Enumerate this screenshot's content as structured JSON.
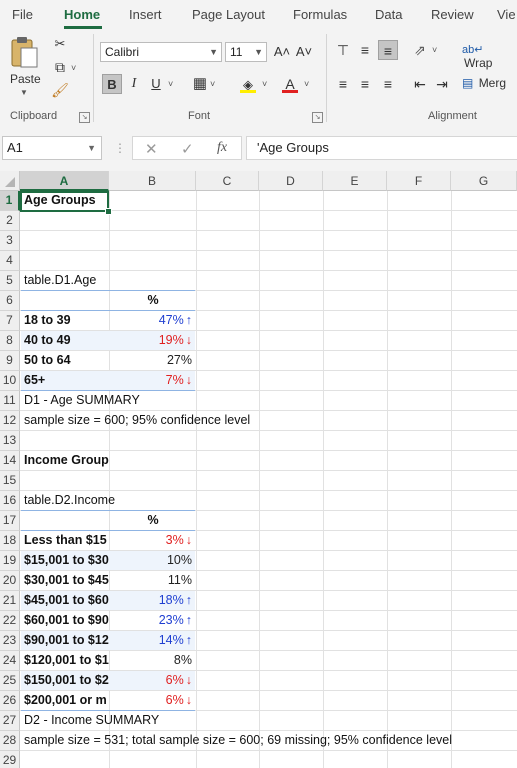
{
  "ribbon": {
    "tabs": [
      "File",
      "Home",
      "Insert",
      "Page Layout",
      "Formulas",
      "Data",
      "Review",
      "Vie"
    ],
    "active_tab": "Home",
    "clipboard": {
      "paste_label": "Paste",
      "group_label": "Clipboard"
    },
    "font": {
      "name": "Calibri",
      "size": "11",
      "bold": "B",
      "italic": "I",
      "underline": "U",
      "grow": "A˄",
      "shrink": "A˅",
      "font_color_letter": "A",
      "group_label": "Font"
    },
    "alignment": {
      "wrap_label": "Wrap",
      "merge_label": "Merg",
      "group_label": "Alignment"
    },
    "colors": {
      "accent": "#1e6c41",
      "highlight": "#ffee00",
      "font_color": "#e02020"
    }
  },
  "formula_bar": {
    "name_box": "A1",
    "formula": "'Age Groups",
    "fx_label": "fx"
  },
  "columns": [
    "A",
    "B",
    "C",
    "D",
    "E",
    "F",
    "G"
  ],
  "rows": [
    "1",
    "2",
    "3",
    "4",
    "5",
    "6",
    "7",
    "8",
    "9",
    "10",
    "11",
    "12",
    "13",
    "14",
    "15",
    "16",
    "17",
    "18",
    "19",
    "20",
    "21",
    "22",
    "23",
    "24",
    "25",
    "26",
    "27",
    "28",
    "29"
  ],
  "age": {
    "title": "Age Groups",
    "table_name": "table.D1.Age",
    "pct_header": "%",
    "rows": [
      {
        "label": "18 to 39",
        "value": "47%",
        "arrow": "↑",
        "trend": "up"
      },
      {
        "label": "40 to 49",
        "value": "19%",
        "arrow": "↓",
        "trend": "down"
      },
      {
        "label": "50 to 64",
        "value": "27%",
        "arrow": "",
        "trend": "neutral"
      },
      {
        "label": "65+",
        "value": "7%",
        "arrow": "↓",
        "trend": "down"
      }
    ],
    "summary": "D1 - Age SUMMARY",
    "sample": "sample size = 600; 95% confidence level"
  },
  "income": {
    "title": "Income Groups",
    "table_name": "table.D2.Income",
    "pct_header": "%",
    "rows": [
      {
        "label": "Less than $15",
        "value": "3%",
        "arrow": "↓",
        "trend": "down"
      },
      {
        "label": "$15,001 to $30",
        "value": "10%",
        "arrow": "",
        "trend": "neutral"
      },
      {
        "label": "$30,001 to $45",
        "value": "11%",
        "arrow": "",
        "trend": "neutral"
      },
      {
        "label": "$45,001 to $60",
        "value": "18%",
        "arrow": "↑",
        "trend": "up"
      },
      {
        "label": "$60,001 to $90",
        "value": "23%",
        "arrow": "↑",
        "trend": "up"
      },
      {
        "label": "$90,001 to $12",
        "value": "14%",
        "arrow": "↑",
        "trend": "up"
      },
      {
        "label": "$120,001 to $1",
        "value": "8%",
        "arrow": "",
        "trend": "neutral"
      },
      {
        "label": "$150,001 to $2",
        "value": "6%",
        "arrow": "↓",
        "trend": "down"
      },
      {
        "label": "$200,001 or m",
        "value": "6%",
        "arrow": "↓",
        "trend": "down"
      }
    ],
    "summary": "D2 - Income SUMMARY",
    "sample": "sample size = 531; total sample size = 600; 69 missing; 95% confidence level"
  }
}
